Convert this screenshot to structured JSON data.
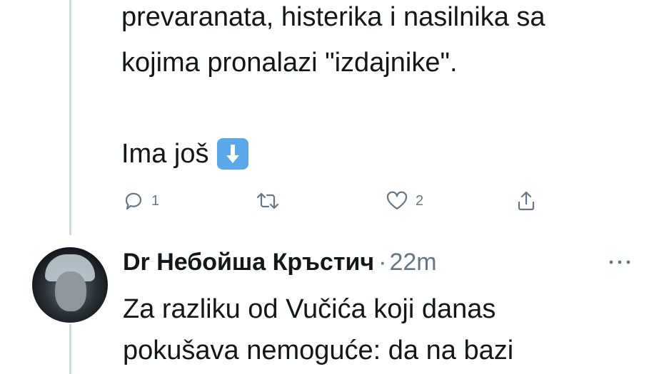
{
  "tweet1": {
    "lines": [
      "prevaranata, histerika i nasilnika sa",
      "kojima pronalazi \"izdajnike\"."
    ],
    "more_text": "Ima još",
    "more_emoji_icon": "down-arrow-emoji-icon",
    "actions": {
      "reply_count": "1",
      "retweet_count": "",
      "like_count": "2"
    }
  },
  "reply": {
    "author_name": "Dr Небойша Кръстич",
    "separator": "·",
    "time": "22m",
    "lines": [
      "Za razliku od Vučića koji danas",
      "pokušava nemoguće: da na bazi"
    ]
  },
  "colors": {
    "text": "#14171a",
    "muted": "#657786",
    "thread_line": "#cfd9de",
    "emoji_blue": "#5aa8e8"
  }
}
